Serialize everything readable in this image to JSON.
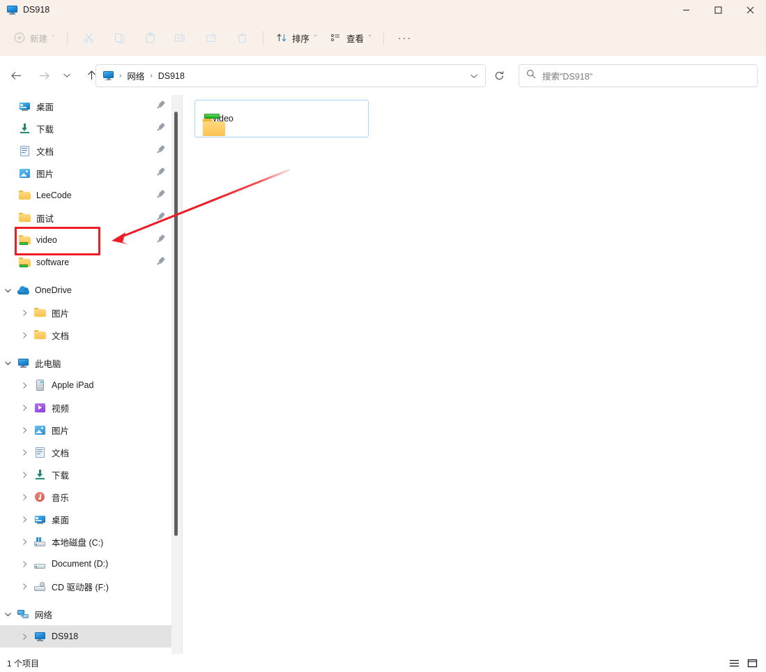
{
  "window": {
    "title": "DS918",
    "title_icon": "monitor-icon",
    "minimize": "—",
    "maximize": "□",
    "close": "✕"
  },
  "toolbar": {
    "new_label": "新建",
    "new_icon": "plus-circle-icon",
    "cut_icon": "scissors-icon",
    "copy_icon": "copy-icon",
    "paste_icon": "paste-icon",
    "rename_icon": "rename-icon",
    "share_icon": "share-icon",
    "delete_icon": "trash-icon",
    "sort_label": "排序",
    "sort_icon": "sort-arrows-icon",
    "view_label": "查看",
    "view_icon": "view-list-icon",
    "more_label": "···",
    "chevron": "ˇ"
  },
  "nav": {
    "back_icon": "arrow-left-icon",
    "forward_icon": "arrow-right-icon",
    "recent_icon": "chevron-down-icon",
    "up_icon": "arrow-up-icon",
    "refresh_icon": "refresh-icon",
    "address_dropdown_icon": "chevron-down-icon"
  },
  "breadcrumb": {
    "root_icon": "monitor-icon",
    "separator": "›",
    "items": [
      {
        "label": "网络"
      },
      {
        "label": "DS918"
      }
    ]
  },
  "search": {
    "icon": "search-icon",
    "placeholder": "搜索\"DS918\""
  },
  "sidebar": {
    "quick_access": [
      {
        "label": "桌面",
        "icon": "desktop-icon",
        "pinned": true
      },
      {
        "label": "下载",
        "icon": "download-icon",
        "pinned": true
      },
      {
        "label": "文档",
        "icon": "document-icon",
        "pinned": true
      },
      {
        "label": "图片",
        "icon": "pictures-icon",
        "pinned": true
      },
      {
        "label": "LeeCode",
        "icon": "folder-icon",
        "pinned": true
      },
      {
        "label": "面试",
        "icon": "folder-icon",
        "pinned": true
      },
      {
        "label": "video",
        "icon": "shared-folder-icon",
        "pinned": true,
        "highlighted": true
      },
      {
        "label": "software",
        "icon": "shared-folder-icon",
        "pinned": true
      }
    ],
    "onedrive": {
      "label": "OneDrive",
      "icon": "cloud-icon",
      "expanded": true,
      "children": [
        {
          "label": "图片",
          "icon": "folder-icon"
        },
        {
          "label": "文档",
          "icon": "folder-icon"
        }
      ]
    },
    "this_pc": {
      "label": "此电脑",
      "icon": "monitor-icon",
      "expanded": true,
      "children": [
        {
          "label": "Apple iPad",
          "icon": "ipad-icon"
        },
        {
          "label": "视频",
          "icon": "video-icon"
        },
        {
          "label": "图片",
          "icon": "pictures-icon"
        },
        {
          "label": "文档",
          "icon": "document-icon"
        },
        {
          "label": "下载",
          "icon": "download-icon"
        },
        {
          "label": "音乐",
          "icon": "music-icon"
        },
        {
          "label": "桌面",
          "icon": "desktop-icon"
        },
        {
          "label": "本地磁盘 (C:)",
          "icon": "system-drive-icon"
        },
        {
          "label": "Document (D:)",
          "icon": "drive-icon"
        },
        {
          "label": "CD 驱动器 (F:)",
          "icon": "cd-drive-icon"
        }
      ]
    },
    "network": {
      "label": "网络",
      "icon": "network-icon",
      "expanded": true,
      "children": [
        {
          "label": "DS918",
          "icon": "monitor-icon",
          "selected": true
        }
      ]
    }
  },
  "content": {
    "items": [
      {
        "name": "video",
        "icon": "shared-folder-icon",
        "selected": true
      }
    ]
  },
  "statusbar": {
    "item_count": "1 个项目",
    "details_view_icon": "list-view-icon",
    "large_icons_view_icon": "large-icons-view-icon"
  },
  "annotations": {
    "highlight_box_target": "video",
    "arrow_color": "#ee1c25",
    "box_color": "#ee1c25"
  }
}
